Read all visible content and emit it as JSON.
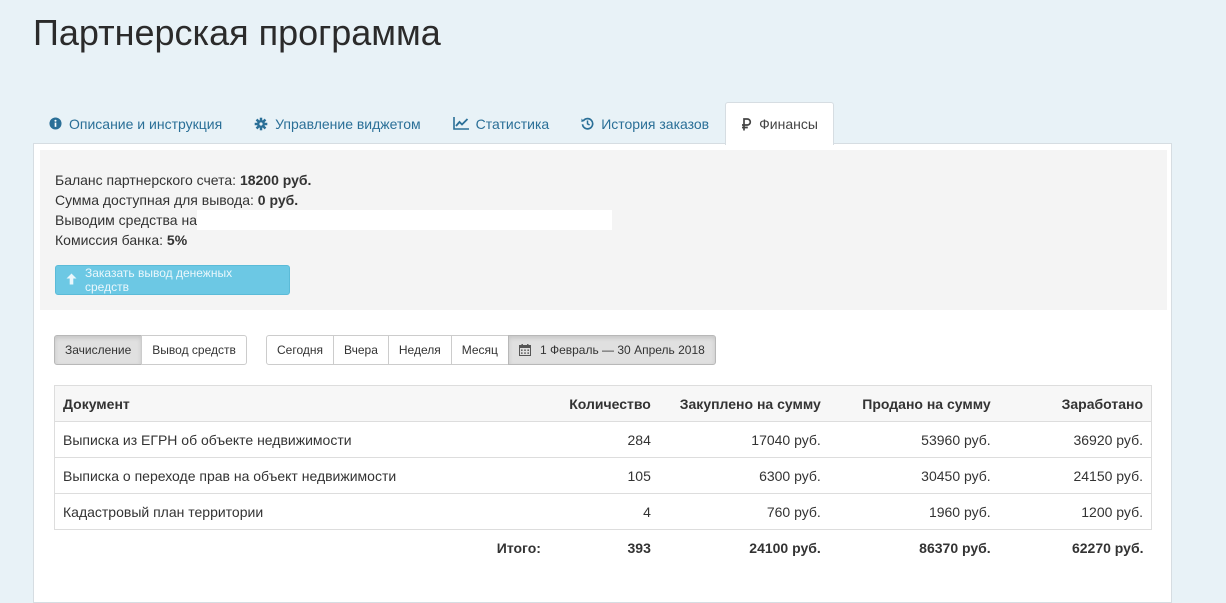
{
  "page": {
    "title": "Партнерская программа"
  },
  "tabs": [
    {
      "label": "Описание и инструкция",
      "icon": "info-circle-icon",
      "active": false
    },
    {
      "label": "Управление виджетом",
      "icon": "gear-icon",
      "active": false
    },
    {
      "label": "Статистика",
      "icon": "line-chart-icon",
      "active": false
    },
    {
      "label": "История заказов",
      "icon": "history-icon",
      "active": false
    },
    {
      "label": "Финансы",
      "icon": "ruble-icon",
      "active": true
    }
  ],
  "finance": {
    "balance_label": "Баланс партнерского счета:",
    "balance_value": "18200 руб.",
    "available_label": "Сумма доступная для вывода:",
    "available_value": "0 руб.",
    "withdraw_to_label": "Выводим средства на",
    "commission_label": "Комиссия банка:",
    "commission_value": "5%",
    "withdraw_button": "Заказать вывод денежных средств"
  },
  "type_filter": {
    "accrual": "Зачисление",
    "withdrawal": "Вывод средств",
    "selected": "Зачисление"
  },
  "period_filter": {
    "today": "Сегодня",
    "yesterday": "Вчера",
    "week": "Неделя",
    "month": "Месяц",
    "date_range": "1 Февраль — 30 Апрель 2018"
  },
  "table": {
    "headers": {
      "document": "Документ",
      "quantity": "Количество",
      "bought": "Закуплено на сумму",
      "sold": "Продано на сумму",
      "earned": "Заработано"
    },
    "rows": [
      {
        "document": "Выписка из ЕГРН об объекте недвижимости",
        "quantity": "284",
        "bought": "17040 руб.",
        "sold": "53960 руб.",
        "earned": "36920 руб."
      },
      {
        "document": "Выписка о переходе прав на объект недвижимости",
        "quantity": "105",
        "bought": "6300 руб.",
        "sold": "30450 руб.",
        "earned": "24150 руб."
      },
      {
        "document": "Кадастровый план территории",
        "quantity": "4",
        "bought": "760 руб.",
        "sold": "1960 руб.",
        "earned": "1200 руб."
      }
    ],
    "totals": {
      "label": "Итого:",
      "quantity": "393",
      "bought": "24100 руб.",
      "sold": "86370 руб.",
      "earned": "62270 руб."
    }
  },
  "colors": {
    "link": "#2a6f97",
    "button_info": "#6cc8e4",
    "background": "#e8f2f7"
  }
}
